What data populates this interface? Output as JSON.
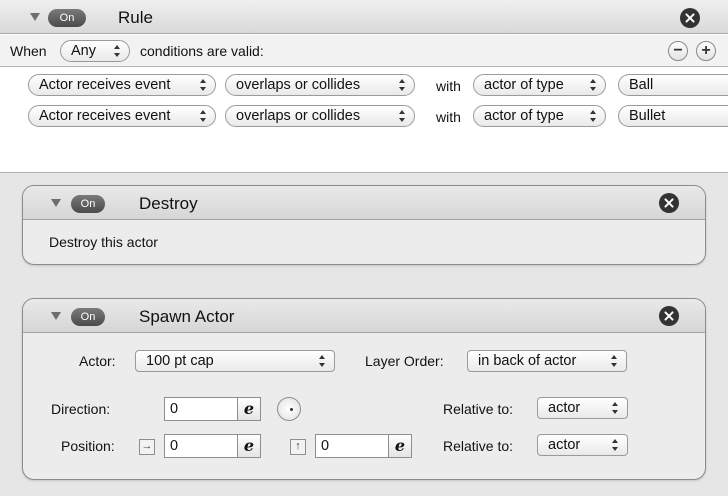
{
  "rule": {
    "on_label": "On",
    "title": "Rule",
    "when_label": "When",
    "match_value": "Any",
    "conditions_suffix": "conditions are valid:",
    "conditions": [
      {
        "event": "Actor receives event",
        "type": "overlaps or collides",
        "with_label": "with",
        "target_kind": "actor of type",
        "target": "Ball"
      },
      {
        "event": "Actor receives event",
        "type": "overlaps or collides",
        "with_label": "with",
        "target_kind": "actor of type",
        "target": "Bullet"
      }
    ]
  },
  "behaviors": {
    "destroy": {
      "on_label": "On",
      "title": "Destroy",
      "description": "Destroy this actor"
    },
    "spawn": {
      "on_label": "On",
      "title": "Spawn Actor",
      "actor_label": "Actor:",
      "actor_value": "100 pt cap",
      "layer_label": "Layer Order:",
      "layer_value": "in back of actor",
      "direction_label": "Direction:",
      "direction_value": "0",
      "relative_label_1": "Relative to:",
      "relative_value_1": "actor",
      "position_label": "Position:",
      "position_x": "0",
      "position_y": "0",
      "relative_label_2": "Relative to:",
      "relative_value_2": "actor",
      "expression_glyph": "e"
    }
  },
  "icons": {
    "collapse": "disclosure-triangle-icon",
    "close": "close-circle-icon",
    "remove": "minus-circle-icon",
    "add": "plus-circle-icon",
    "dial": "direction-dial-icon",
    "x_axis": "arrow-right-box-icon",
    "y_axis": "arrow-up-box-icon"
  }
}
